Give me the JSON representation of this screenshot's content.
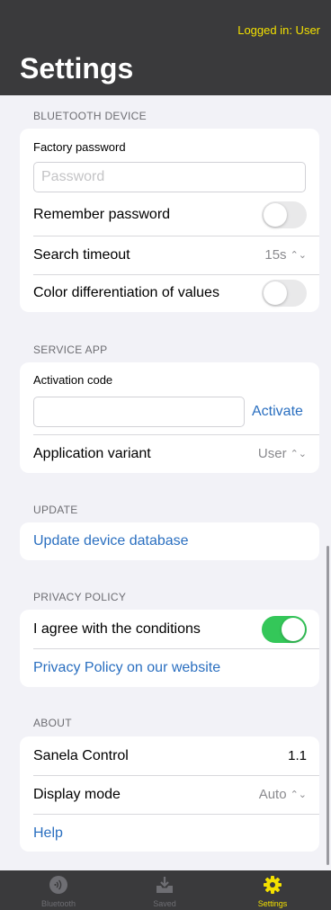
{
  "header": {
    "login_status": "Logged in: User",
    "title": "Settings"
  },
  "sections": {
    "bluetooth": {
      "header": "BLUETOOTH DEVICE",
      "factory_password_label": "Factory password",
      "password_placeholder": "Password",
      "remember_password_label": "Remember password",
      "remember_password_on": false,
      "search_timeout_label": "Search timeout",
      "search_timeout_value": "15s",
      "color_diff_label": "Color differentiation of values",
      "color_diff_on": false
    },
    "service_app": {
      "header": "SERVICE APP",
      "activation_code_label": "Activation code",
      "activation_code_value": "",
      "activate_label": "Activate",
      "app_variant_label": "Application variant",
      "app_variant_value": "User"
    },
    "update": {
      "header": "UPDATE",
      "update_db_label": "Update device database"
    },
    "privacy": {
      "header": "PRIVACY POLICY",
      "agree_label": "I agree with the conditions",
      "agree_on": true,
      "website_link": "Privacy Policy on our website"
    },
    "about": {
      "header": "ABOUT",
      "app_name": "Sanela Control",
      "app_version": "1.1",
      "display_mode_label": "Display mode",
      "display_mode_value": "Auto",
      "help_label": "Help"
    }
  },
  "tabbar": {
    "tabs": [
      {
        "label": "Bluetooth",
        "icon": "bluetooth-signal-icon",
        "active": false
      },
      {
        "label": "Saved",
        "icon": "download-tray-icon",
        "active": false
      },
      {
        "label": "Settings",
        "icon": "gear-icon",
        "active": true
      }
    ]
  },
  "colors": {
    "accent_link": "#2a6fc0",
    "toggle_on": "#34c759",
    "active_tab": "#f3e000",
    "bar_background": "#3a3a3c"
  }
}
